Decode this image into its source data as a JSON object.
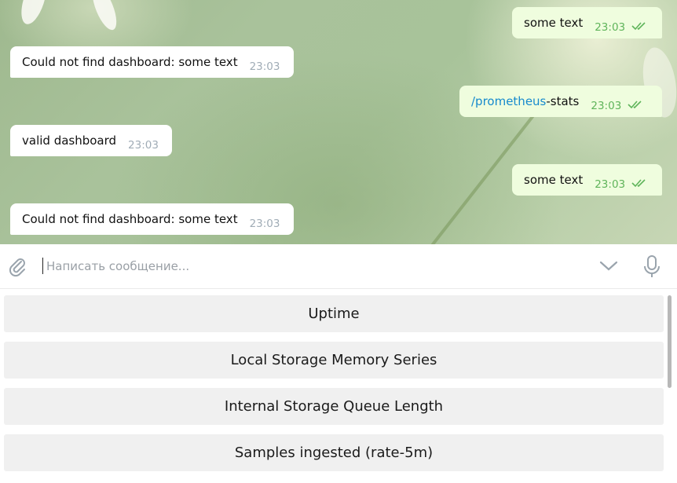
{
  "messages": [
    {
      "dir": "out",
      "text": "some text",
      "time": "23:03"
    },
    {
      "dir": "in",
      "text": "Could not find dashboard: some text",
      "time": "23:03"
    },
    {
      "dir": "out",
      "command": "/prometheus",
      "rest": "-stats",
      "time": "23:03"
    },
    {
      "dir": "in",
      "text": "valid dashboard",
      "time": "23:03"
    },
    {
      "dir": "out",
      "text": "some text",
      "time": "23:03"
    },
    {
      "dir": "in",
      "text": "Could not find dashboard: some text",
      "time": "23:03"
    }
  ],
  "composer": {
    "placeholder": "Написать сообщение..."
  },
  "keyboard": {
    "buttons": [
      "Uptime",
      "Local Storage Memory Series",
      "Internal Storage Queue Length",
      "Samples ingested (rate-5m)"
    ]
  },
  "colors": {
    "outgoing_bubble": "#effdde",
    "incoming_bubble": "#ffffff",
    "read_ticks": "#5fb45a",
    "command_link": "#168acd",
    "keyboard_button": "#f0f0f0"
  },
  "icons": [
    "attach-icon",
    "chevron-down-icon",
    "microphone-icon",
    "double-check-icon"
  ]
}
